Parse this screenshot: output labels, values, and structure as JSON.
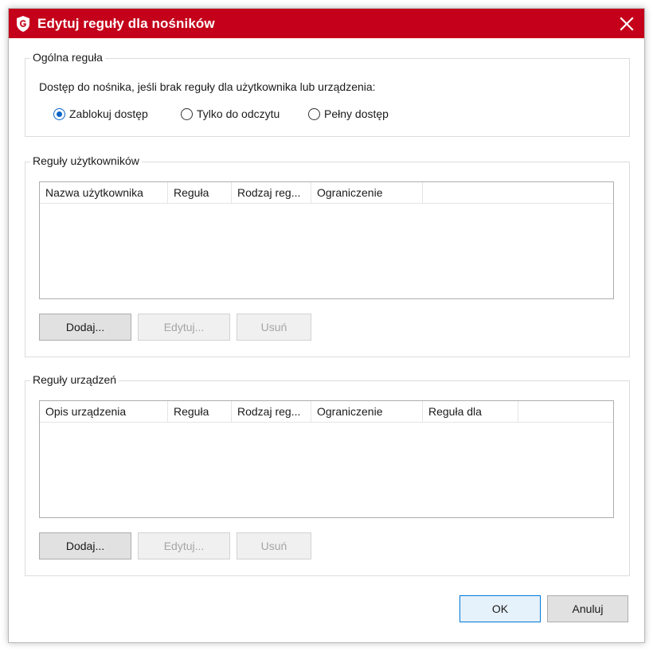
{
  "window": {
    "title": "Edytuj reguły dla nośników"
  },
  "general_rule": {
    "legend": "Ogólna reguła",
    "description": "Dostęp do nośnika, jeśli brak reguły dla użytkownika lub urządzenia:",
    "options": [
      {
        "label": "Zablokuj dostęp",
        "checked": true
      },
      {
        "label": "Tylko do odczytu",
        "checked": false
      },
      {
        "label": "Pełny dostęp",
        "checked": false
      }
    ]
  },
  "user_rules": {
    "legend": "Reguły użytkowników",
    "columns": [
      "Nazwa użytkownika",
      "Reguła",
      "Rodzaj reg...",
      "Ograniczenie"
    ],
    "rows": [],
    "buttons": {
      "add": "Dodaj...",
      "edit": "Edytuj...",
      "remove": "Usuń"
    }
  },
  "device_rules": {
    "legend": "Reguły urządzeń",
    "columns": [
      "Opis urządzenia",
      "Reguła",
      "Rodzaj reg...",
      "Ograniczenie",
      "Reguła dla"
    ],
    "rows": [],
    "buttons": {
      "add": "Dodaj...",
      "edit": "Edytuj...",
      "remove": "Usuń"
    }
  },
  "footer": {
    "ok": "OK",
    "cancel": "Anuluj"
  },
  "colors": {
    "titlebar": "#c4001a",
    "radio_checked": "#0a64c8",
    "default_button_border": "#0078d7"
  },
  "icons": {
    "title": "gdata-shield-icon",
    "close": "close-icon"
  }
}
